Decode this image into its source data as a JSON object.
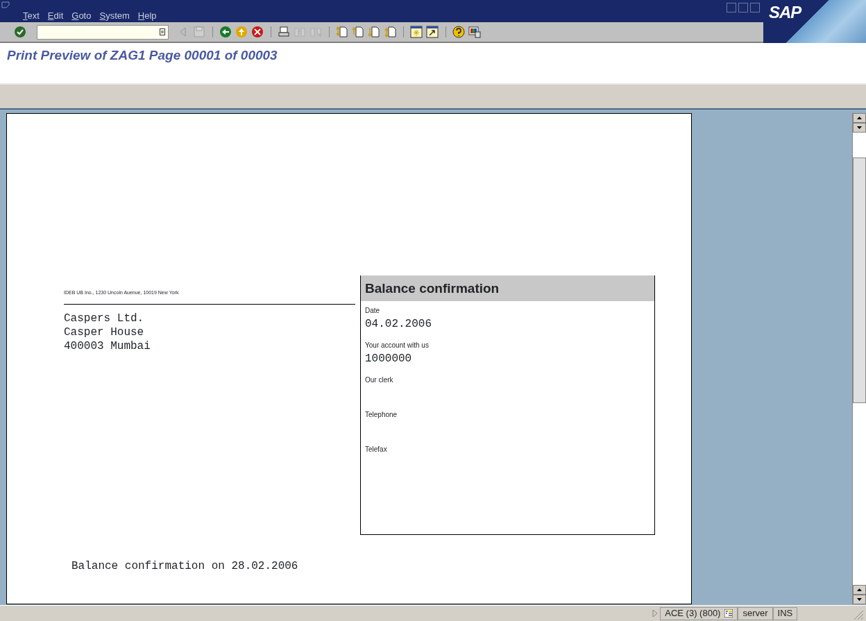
{
  "menu_bar": {
    "items": [
      "Text",
      "Edit",
      "Goto",
      "System",
      "Help"
    ],
    "logo": "SAP"
  },
  "toolbar": {
    "buttons": [
      {
        "kind": "back-triangle",
        "disabled": true
      },
      {
        "kind": "save",
        "disabled": true
      },
      {
        "kind": "sep"
      },
      {
        "kind": "back",
        "disabled": false
      },
      {
        "kind": "exit",
        "disabled": false
      },
      {
        "kind": "cancel",
        "disabled": false
      },
      {
        "kind": "sep"
      },
      {
        "kind": "print",
        "disabled": false
      },
      {
        "kind": "find",
        "disabled": true
      },
      {
        "kind": "find-next",
        "disabled": true
      },
      {
        "kind": "sep"
      },
      {
        "kind": "first-page",
        "disabled": false
      },
      {
        "kind": "prev-page",
        "disabled": false
      },
      {
        "kind": "next-page",
        "disabled": false
      },
      {
        "kind": "last-page",
        "disabled": false
      },
      {
        "kind": "sep"
      },
      {
        "kind": "new-session",
        "disabled": false
      },
      {
        "kind": "shortcut",
        "disabled": false
      },
      {
        "kind": "sep"
      },
      {
        "kind": "help",
        "disabled": false
      },
      {
        "kind": "layout",
        "disabled": false
      }
    ]
  },
  "screen_title": "Print Preview of ZAG1 Page 00001 of 00003",
  "document": {
    "sender_line": "IDEB UB Ino., 1230 Uncoln Auenue, 10019 New York",
    "address": [
      "Caspers Ltd.",
      "Casper House",
      "400003 Mumbai"
    ],
    "info_box": {
      "title": "Balance confirmation",
      "fields": [
        {
          "label": "Date",
          "value": "04.02.2006"
        },
        {
          "label": "Your account with us",
          "value": "1000000"
        },
        {
          "label": "Our clerk"
        },
        {
          "label": "Telephone"
        },
        {
          "label": "Telefax"
        }
      ]
    },
    "footer_text": "Balance confirmation on 28.02.2006"
  },
  "status_bar": {
    "system": "ACE (3) (800)",
    "server": "server",
    "mode": "INS"
  }
}
